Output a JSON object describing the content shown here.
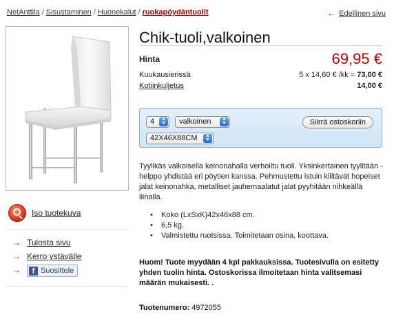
{
  "breadcrumb": {
    "items": [
      "NetAnttila",
      "Sisustaminen",
      "Huonekalut"
    ],
    "separator": "/",
    "current": "ruokapöydäntuolit"
  },
  "back_link": "Edellinen sivu",
  "sidebar": {
    "zoom_label": "Iso tuotekuva",
    "links": [
      "Tulosta sivu",
      "Kerro ystävälle"
    ],
    "facebook_label": "Suosittele"
  },
  "product": {
    "title": "Chik-tuoli,valkoinen",
    "price_label": "Hinta",
    "price": "69,95 €",
    "installment_label": "Kuukausierissä",
    "installment_detail": "5 x 14,60 € /kk = ",
    "installment_total": "73,00 €",
    "shipping_label": "Kotiinkuljetus",
    "shipping_price": "14,00 €"
  },
  "order": {
    "quantity": "4",
    "color": "valkoinen",
    "size": "42X46X88CM",
    "button": "Siirrä ostoskoriin"
  },
  "description": "Tyylikäs valkoisella keinonahalla verhoiltu tuoli. Yksinkertainen tyylitään - helppo yhdistää eri pöytien kanssa. Pehmustettu istuin kiiltävät hopeiset jalat keinonahka, metalliset jauhemaalatut jalat pyyhitään nihkeällä liinalla.",
  "bullets": [
    "Koko (LxSxK)42x46x88 cm.",
    "6,5 kg.",
    "Valmistettu ruotsissa. Toimitetaan osina, koottava."
  ],
  "notice": "Huom! Tuote myydään 4 kpl pakkauksissa. Tuotesivulla on esitetty yhden tuolin hinta. Ostoskorissa ilmoitetaan hinta valitsemasi määrän mukaisesti. .",
  "product_number": {
    "label": "Tuotenumero:",
    "value": "4972055"
  },
  "colors": {
    "price_red": "#c40000",
    "link_arrow_red": "#cc0000",
    "order_box_blue": "#cfe5f6"
  }
}
